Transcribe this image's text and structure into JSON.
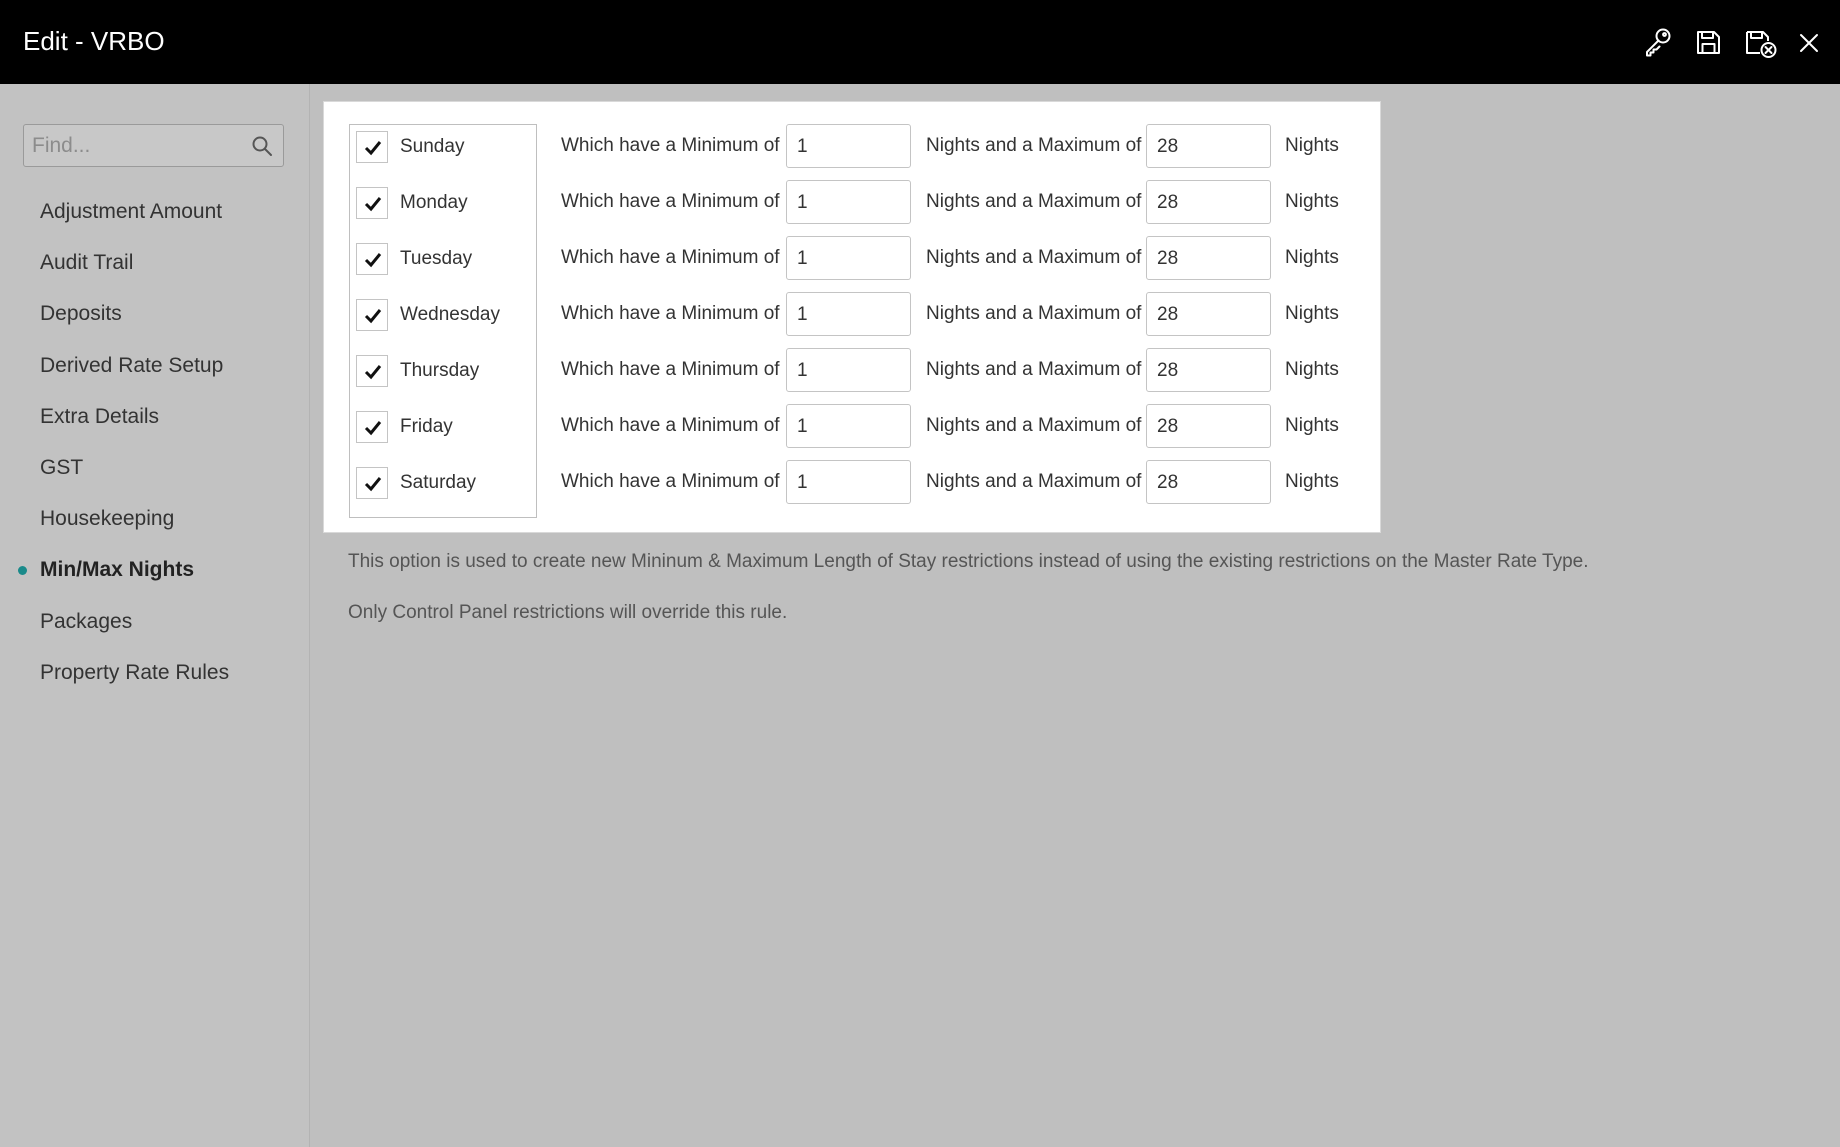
{
  "window": {
    "title": "Edit - VRBO",
    "actions": [
      {
        "name": "key-icon"
      },
      {
        "name": "save-icon"
      },
      {
        "name": "save-close-icon"
      },
      {
        "name": "close-icon"
      }
    ]
  },
  "sidebar": {
    "search_placeholder": "Find...",
    "items": [
      {
        "label": "Adjustment Amount",
        "active": false
      },
      {
        "label": "Audit Trail",
        "active": false
      },
      {
        "label": "Deposits",
        "active": false
      },
      {
        "label": "Derived Rate Setup",
        "active": false
      },
      {
        "label": "Extra Details",
        "active": false
      },
      {
        "label": "GST",
        "active": false
      },
      {
        "label": "Housekeeping",
        "active": false
      },
      {
        "label": "Min/Max Nights",
        "active": true
      },
      {
        "label": "Packages",
        "active": false
      },
      {
        "label": "Property Rate Rules",
        "active": false
      }
    ],
    "active_color": "#1a8a8a"
  },
  "rules": {
    "min_label": "Which have a Minimum of",
    "max_label": "Nights and a Maximum of",
    "nights_label": "Nights",
    "days": [
      {
        "day": "Sunday",
        "checked": true,
        "min": "1",
        "max": "28"
      },
      {
        "day": "Monday",
        "checked": true,
        "min": "1",
        "max": "28"
      },
      {
        "day": "Tuesday",
        "checked": true,
        "min": "1",
        "max": "28"
      },
      {
        "day": "Wednesday",
        "checked": true,
        "min": "1",
        "max": "28"
      },
      {
        "day": "Thursday",
        "checked": true,
        "min": "1",
        "max": "28"
      },
      {
        "day": "Friday",
        "checked": true,
        "min": "1",
        "max": "28"
      },
      {
        "day": "Saturday",
        "checked": true,
        "min": "1",
        "max": "28"
      }
    ]
  },
  "help": {
    "line1": "This option is used to create new Mininum & Maximum Length of Stay restrictions instead of using the existing restrictions on the Master Rate Type.",
    "line2": "Only Control Panel restrictions will override this rule."
  }
}
